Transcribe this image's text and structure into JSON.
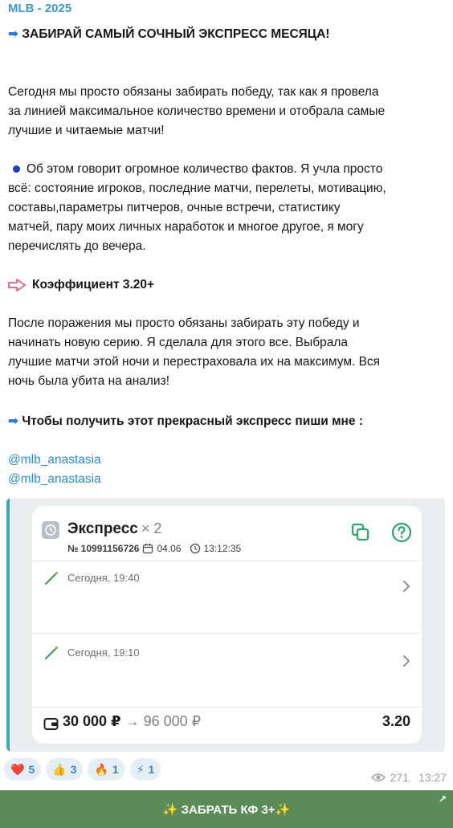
{
  "channel": {
    "name": "MLB - 2025"
  },
  "post": {
    "headline": "ЗАБИРАЙ САМЫЙ СОЧНЫЙ ЭКСПРЕСС МЕСЯЦА!",
    "headline_arrow": "➡",
    "para1": [
      "Сегодня мы просто обязаны забирать победу, так как я провела",
      "за линией максимальное количество времени и отобрала самые",
      "лучшие и читаемые матчи!"
    ],
    "para2": [
      "Об этом говорит огромное количество фактов. Я учла просто",
      "всё: состояние игроков, последние матчи, перелеты, мотивацию,",
      "составы,параметры питчеров, очные встречи, статистику",
      "матчей, пару моих личных наработок и многое другое, я могу",
      "перечислять до вечера."
    ],
    "coef_line": "Коэффициент 3.20+",
    "para3": [
      "После поражения мы просто обязаны забирать эту победу и",
      "начинать новую серию. Я сделала для этого все. Выбрала",
      "лучшие матчи этой ночи и перестраховала их на максимум. Вся",
      "ночь была убита на анализ!"
    ],
    "cta_line": "Чтобы получить этот прекрасный экспресс пиши мне :",
    "cta_arrow": "➡",
    "links": [
      "@mlb_anastasia",
      "@mlb_anastasia"
    ]
  },
  "bet_card": {
    "title": "Экспресс",
    "multiplier": "× 2",
    "number": "№ 10991156726",
    "date": "04.06",
    "time": "13:12:35",
    "events": [
      {
        "time": "Сегодня, 19:40"
      },
      {
        "time": "Сегодня, 19:10"
      }
    ],
    "stake": "30 000 ₽",
    "payout_arrow": "→",
    "payout": "96 000 ₽",
    "coefficient": "3.20",
    "colors": {
      "accent_green": "#2ea36b",
      "frame_accent": "#3aa6b9"
    }
  },
  "reactions": [
    {
      "emoji": "❤️",
      "count": "5"
    },
    {
      "emoji": "👍",
      "count": "3"
    },
    {
      "emoji": "🔥",
      "count": "1"
    },
    {
      "emoji": "⚡",
      "count": "1"
    }
  ],
  "meta": {
    "views": "271",
    "time": "13:27"
  },
  "button": {
    "label": "✨ ЗАБРАТЬ КФ 3+✨",
    "corner": "↗"
  }
}
